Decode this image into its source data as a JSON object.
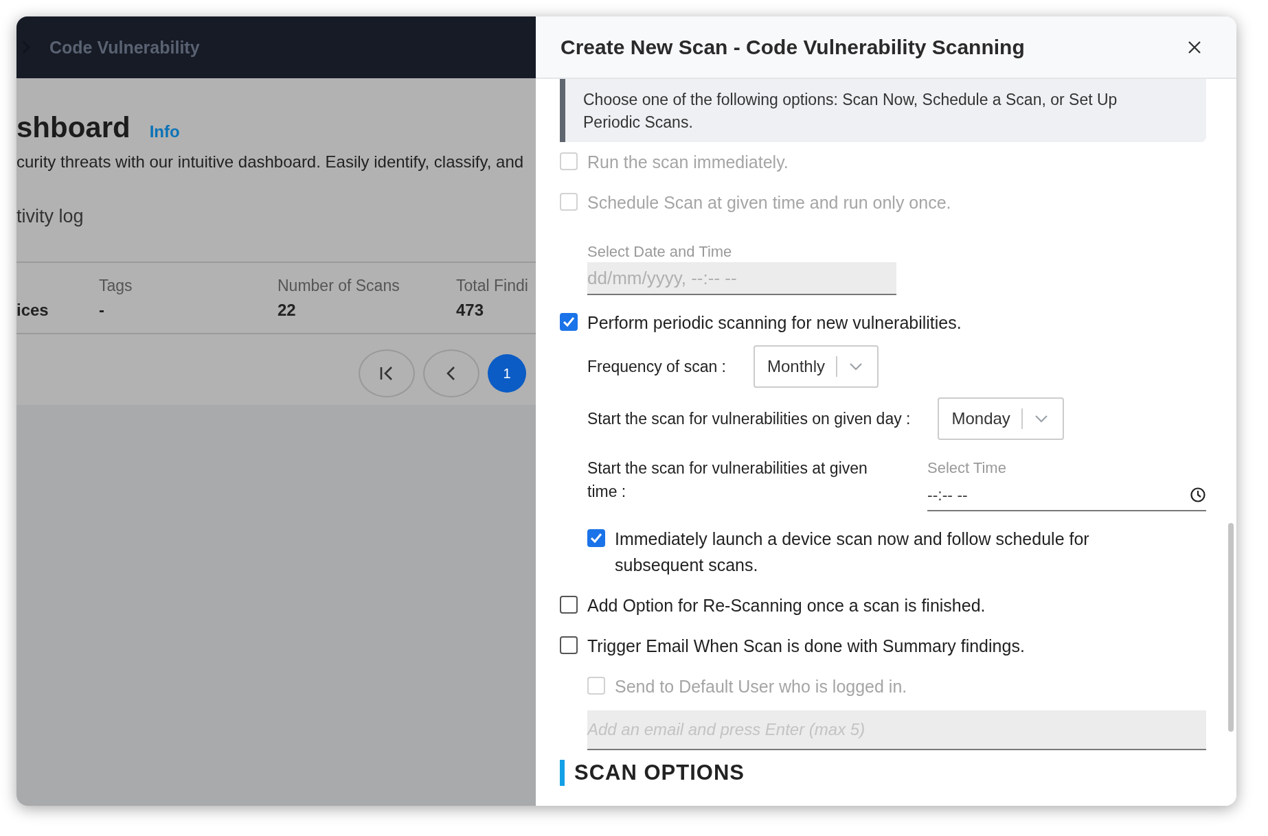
{
  "background": {
    "breadcrumb": "Code Vulnerability",
    "heading": "shboard",
    "info_link": "Info",
    "description": "curity threats with our intuitive dashboard. Easily identify, classify, and",
    "activity_log": "tivity log",
    "table": {
      "columns": [
        "Tags",
        "Number of Scans",
        "Total Findi"
      ],
      "cells": [
        "ices",
        "-",
        "22",
        "473"
      ]
    },
    "pagination": [
      {
        "kind": "first"
      },
      {
        "kind": "prev"
      },
      {
        "kind": "page",
        "label": "1",
        "selected": true
      }
    ]
  },
  "modal": {
    "title": "Create New Scan - Code Vulnerability Scanning",
    "info": "Choose one of the following options: Scan Now, Schedule a Scan, or Set Up Periodic Scans.",
    "items": [
      {
        "kind": "checkbox",
        "label": "Run the scan immediately.",
        "checked": false,
        "disabled": true
      },
      {
        "kind": "checkbox",
        "label": "Schedule Scan at given time and run only once.",
        "checked": false,
        "disabled": true,
        "children": [
          {
            "kind": "datetime",
            "label": "Select Date and Time",
            "placeholder": "dd/mm/yyyy, --:-- --",
            "disabled": true
          }
        ]
      },
      {
        "kind": "checkbox",
        "label": "Perform periodic scanning for new vulnerabilities.",
        "checked": true,
        "disabled": false,
        "children": [
          {
            "kind": "select",
            "label": "Frequency of scan :",
            "value": "Monthly"
          },
          {
            "kind": "select",
            "label": "Start the scan for vulnerabilities on given day :",
            "value": "Monday"
          },
          {
            "kind": "time",
            "label": "Start the scan for vulnerabilities at given time :",
            "field_label": "Select Time",
            "placeholder": "--:-- --"
          },
          {
            "kind": "checkbox",
            "label": "Immediately launch a device scan now and follow schedule for subsequent scans.",
            "checked": true,
            "disabled": false
          }
        ]
      },
      {
        "kind": "checkbox",
        "label": "Add Option for Re-Scanning once a scan is finished.",
        "checked": false,
        "disabled": false
      },
      {
        "kind": "checkbox",
        "label": "Trigger Email When Scan is done with Summary findings.",
        "checked": false,
        "disabled": false,
        "children": [
          {
            "kind": "checkbox",
            "label": "Send to Default User who is logged in.",
            "checked": false,
            "disabled": true
          },
          {
            "kind": "email",
            "placeholder": "Add an email and press Enter (max 5)"
          }
        ]
      },
      {
        "kind": "section",
        "label": "SCAN OPTIONS"
      }
    ]
  }
}
